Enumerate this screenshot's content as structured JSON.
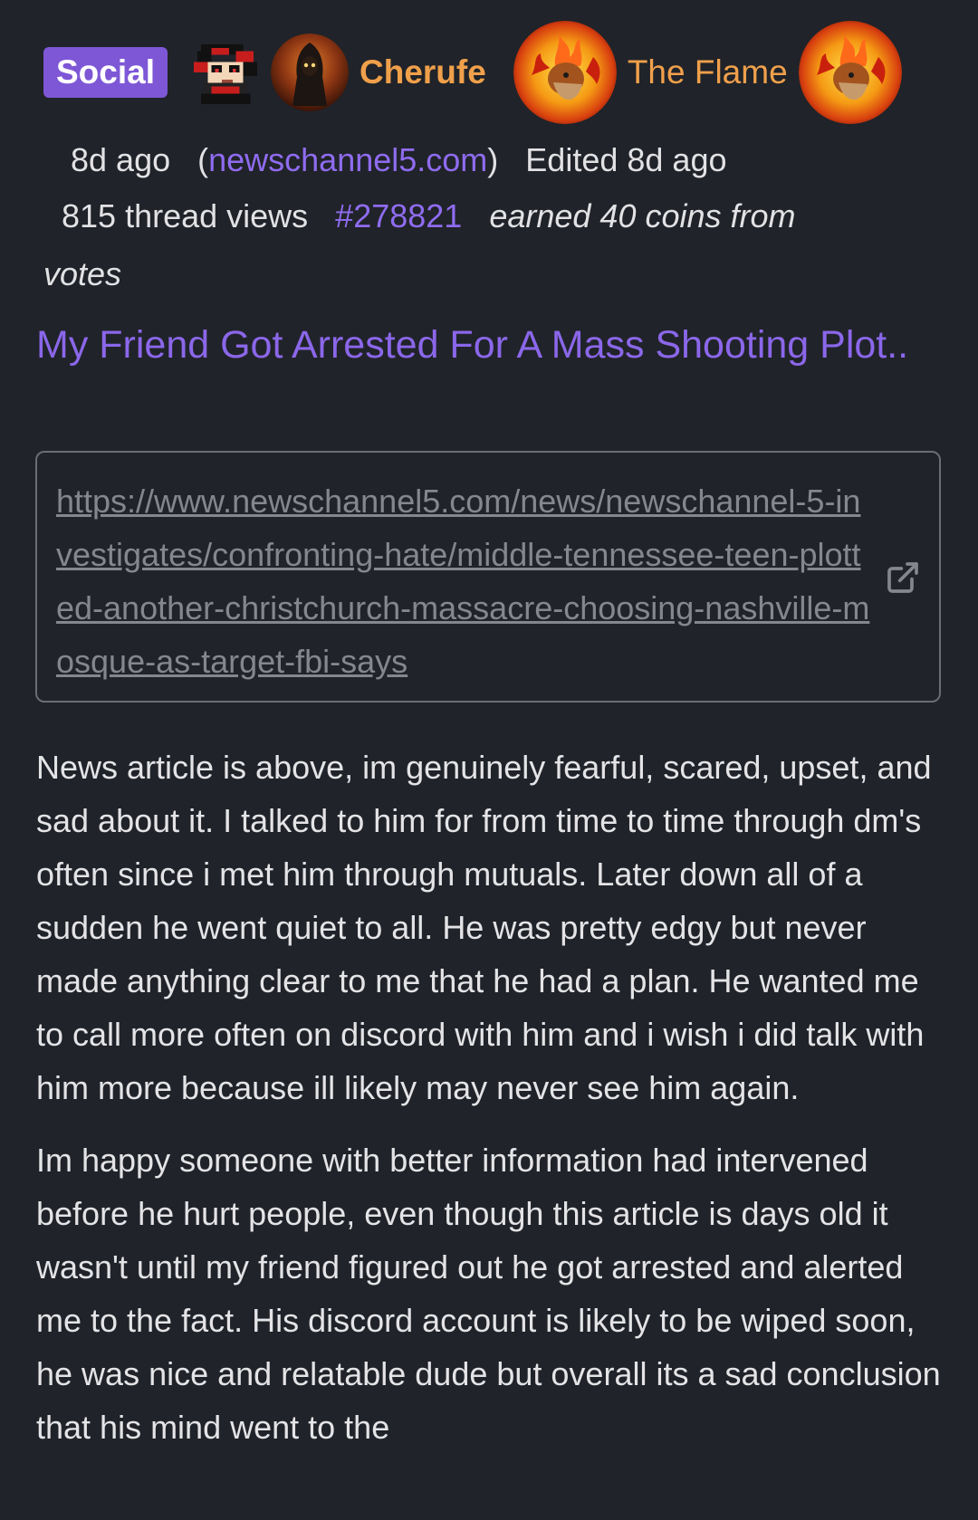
{
  "post": {
    "category": "Social",
    "author": "Cherufe",
    "flair_text": "The Flame",
    "posted": "8d ago",
    "source_domain": "newschannel5.com",
    "edited": "Edited 8d ago",
    "views": "815 thread views",
    "thread_id": "#278821",
    "coins_line1": "earned 40 coins from",
    "coins_line2": "votes",
    "title": "My Friend Got Arrested For A Mass Shooting Plot..",
    "link_url": "https://www.newschannel5.com/news/newschannel-5-investigates/confronting-hate/middle-tennessee-teen-plotted-another-christchurch-massacre-choosing-nashville-mosque-as-target-fbi-says",
    "body": {
      "p1": "News article is above, im genuinely fearful, scared, upset, and sad about it. I talked to him for from time to time through dm's often since i met him through mutuals. Later down all of a sudden he went quiet to all. He was pretty edgy but never made anything clear to me that he had a plan. He wanted me to call more often on discord with him and i wish i did talk with him more because ill likely may never see him again.",
      "p2": "Im happy someone with better information had intervened before he hurt people, even though this article is days old it wasn't until my friend figured out he got arrested and alerted me to the fact. His discord account is likely to be wiped soon, he was nice and relatable dude but overall its a sad conclusion that his mind went to the"
    }
  },
  "icons": {
    "external_link": "external-link-icon",
    "pixel_avatar": "pixel-character-avatar",
    "user_avatar": "hooded-figure-avatar",
    "flame_avatar": "fire-bird-avatar"
  },
  "colors": {
    "background": "#202329",
    "badge": "#7e57d6",
    "username": "#f0a04b",
    "accent_link": "#8f6cf0",
    "title": "#8b67ea"
  }
}
